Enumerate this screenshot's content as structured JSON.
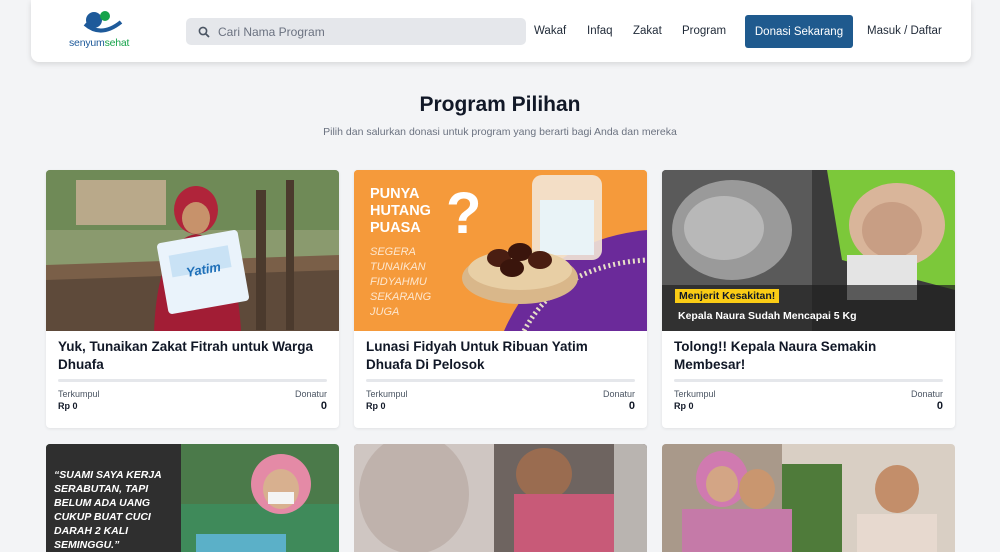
{
  "brand": {
    "logo_part1": "senyum",
    "logo_part2": "sehat",
    "colors": {
      "primary": "#1f5a8e",
      "green": "#16a34a"
    }
  },
  "nav": {
    "search_placeholder": "Cari Nama Program",
    "links": [
      "Wakaf",
      "Infaq",
      "Zakat",
      "Program"
    ],
    "donate_label": "Donasi Sekarang",
    "login_label": "Masuk / Daftar"
  },
  "section": {
    "title": "Program Pilihan",
    "subtitle": "Pilih dan salurkan donasi untuk program yang berarti bagi Anda dan mereka"
  },
  "cards": [
    {
      "title": "Yuk, Tunaikan Zakat Fitrah untuk Warga Dhuafa",
      "collected_label": "Terkumpul",
      "collected_value": "Rp 0",
      "donor_label": "Donatur",
      "donor_value": "0",
      "progress": 0,
      "image_text": "Yatim"
    },
    {
      "title": "Lunasi Fidyah Untuk Ribuan Yatim Dhuafa Di Pelosok",
      "collected_label": "Terkumpul",
      "collected_value": "Rp 0",
      "donor_label": "Donatur",
      "donor_value": "0",
      "progress": 0,
      "image_heading": [
        "PUNYA",
        "HUTANG",
        "PUASA"
      ],
      "image_sub": [
        "SEGERA",
        "TUNAIKAN",
        "FIDYAHMU",
        "SEKARANG",
        "JUGA"
      ],
      "image_mark": "?"
    },
    {
      "title": "Tolong!! Kepala Naura Semakin Membesar!",
      "collected_label": "Terkumpul",
      "collected_value": "Rp 0",
      "donor_label": "Donatur",
      "donor_value": "0",
      "progress": 0,
      "image_tag": "Menjerit Kesakitan!",
      "image_caption": "Kepala Naura Sudah Mencapai 5 Kg"
    }
  ],
  "row2": {
    "quote": "“SUAMI SAYA KERJA SERABUTAN, TAPI BELUM ADA UANG CUKUP BUAT CUCI DARAH 2 KALI SEMINGGU.”"
  }
}
